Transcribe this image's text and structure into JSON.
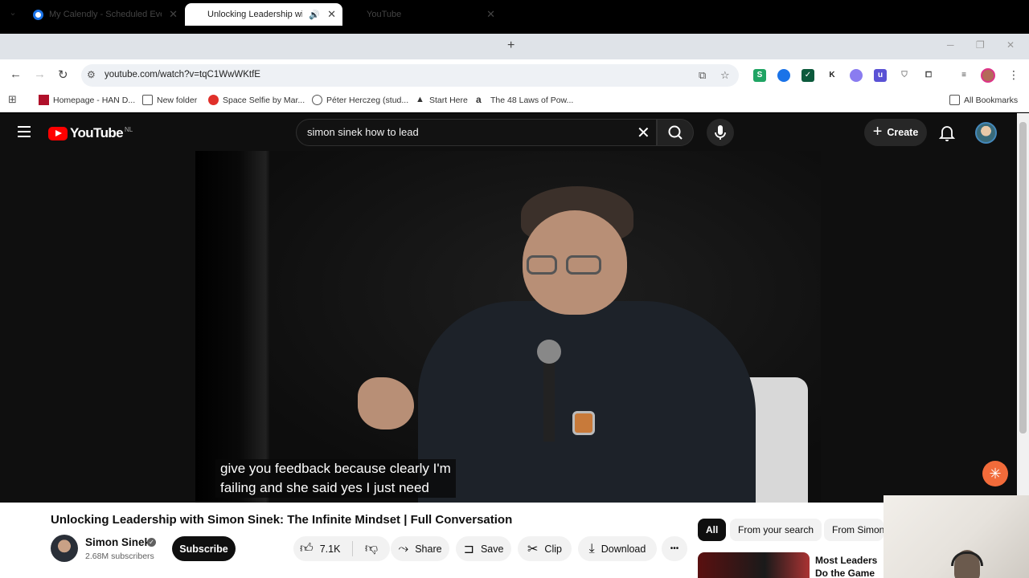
{
  "browser": {
    "tabs": [
      {
        "title": "My Calendly - Scheduled Event",
        "active": false
      },
      {
        "title": "Unlocking Leadership with",
        "active": true
      },
      {
        "title": "YouTube",
        "active": false
      }
    ],
    "url": "youtube.com/watch?v=tqC1WwWKtfE",
    "bookmarks": [
      {
        "label": "Homepage - HAN D..."
      },
      {
        "label": "New folder"
      },
      {
        "label": "Space Selfie by Mar..."
      },
      {
        "label": "Péter Herczeg (stud..."
      },
      {
        "label": "Start Here"
      },
      {
        "label": "The 48 Laws of Pow..."
      }
    ],
    "all_bookmarks": "All Bookmarks",
    "extensions": [
      {
        "letter": "S",
        "color": "#1fa463"
      },
      {
        "letter": "",
        "color": "#1a73e8"
      },
      {
        "letter": "✓",
        "color": "#0c5a3c"
      },
      {
        "letter": "K",
        "color": "#ffffff"
      },
      {
        "letter": "",
        "color": "#8a7cf0"
      },
      {
        "letter": "u",
        "color": "#5a52d5"
      }
    ]
  },
  "youtube": {
    "logo_text": "YouTube",
    "region": "NL",
    "search_query": "simon sinek how to lead",
    "create_label": "Create",
    "caption_line1": "give you feedback because clearly I'm",
    "caption_line2": "failing and she said yes I just need",
    "video_title": "Unlocking Leadership with Simon Sinek: The Infinite Mindset | Full Conversation",
    "channel_name": "Simon Sinek",
    "subscribers": "2.68M subscribers",
    "subscribe_label": "Subscribe",
    "likes": "7.1K",
    "share_label": "Share",
    "save_label": "Save",
    "clip_label": "Clip",
    "download_label": "Download",
    "more_label": "•••",
    "filters": [
      "All",
      "From your search",
      "From Simon"
    ],
    "rec_title": "Most Leaders Do the Game They'r"
  }
}
